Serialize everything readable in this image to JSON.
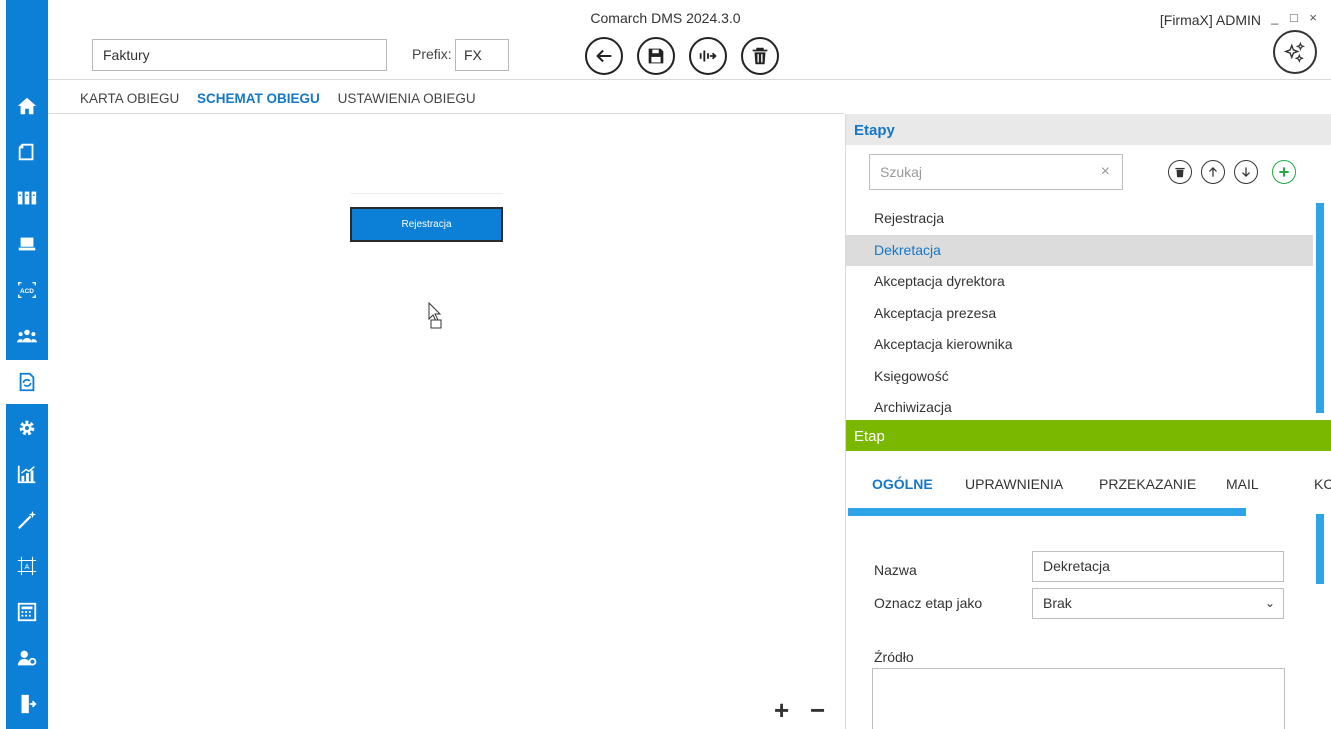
{
  "app": {
    "title": "Comarch DMS 2024.3.0",
    "user_info": "[FirmaX]  ADMIN",
    "window_controls": "_ □ ×"
  },
  "header": {
    "name_value": "Faktury",
    "prefix_label": "Prefix:",
    "prefix_value": "FX",
    "buttons": [
      "back-icon",
      "save-icon",
      "merge-icon",
      "delete-icon",
      "magic-icon"
    ]
  },
  "sidebar": {
    "items": [
      "home-icon",
      "documents-icon",
      "binders-icon",
      "laptop-icon",
      "acd-icon",
      "users-icon",
      "workflow-icon",
      "settings-icon",
      "reports-icon",
      "wand-icon",
      "template-icon",
      "calculator-icon",
      "user-settings-icon",
      "exit-icon"
    ],
    "active": "workflow-icon"
  },
  "tabs": {
    "items": [
      "KARTA OBIEGU",
      "SCHEMAT OBIEGU",
      "USTAWIENIA OBIEGU"
    ],
    "active": "SCHEMAT OBIEGU"
  },
  "canvas": {
    "node_label": "Rejestracja",
    "zoom_in": "+",
    "zoom_out": "−"
  },
  "etapy": {
    "title": "Etapy",
    "search_placeholder": "Szukaj",
    "search_clear": "×",
    "stages": [
      "Rejestracja",
      "Dekretacja",
      "Akceptacja dyrektora",
      "Akceptacja prezesa",
      "Akceptacja kierownika",
      "Księgowość",
      "Archiwizacja"
    ],
    "selected": "Dekretacja"
  },
  "etap": {
    "title": "Etap",
    "subtabs": [
      "OGÓLNE",
      "UPRAWNIENIA",
      "PRZEKAZANIE",
      "MAIL",
      "KC"
    ],
    "active_subtab": "OGÓLNE",
    "nazwa_label": "Nazwa",
    "nazwa_value": "Dekretacja",
    "oznacz_label": "Oznacz etap jako",
    "oznacz_value": "Brak",
    "zrodlo_label": "Źródło"
  },
  "colors": {
    "accent_blue": "#0c7fd6",
    "link_blue": "#1477c9",
    "green_header": "#7ab800",
    "add_green": "#22a844"
  }
}
